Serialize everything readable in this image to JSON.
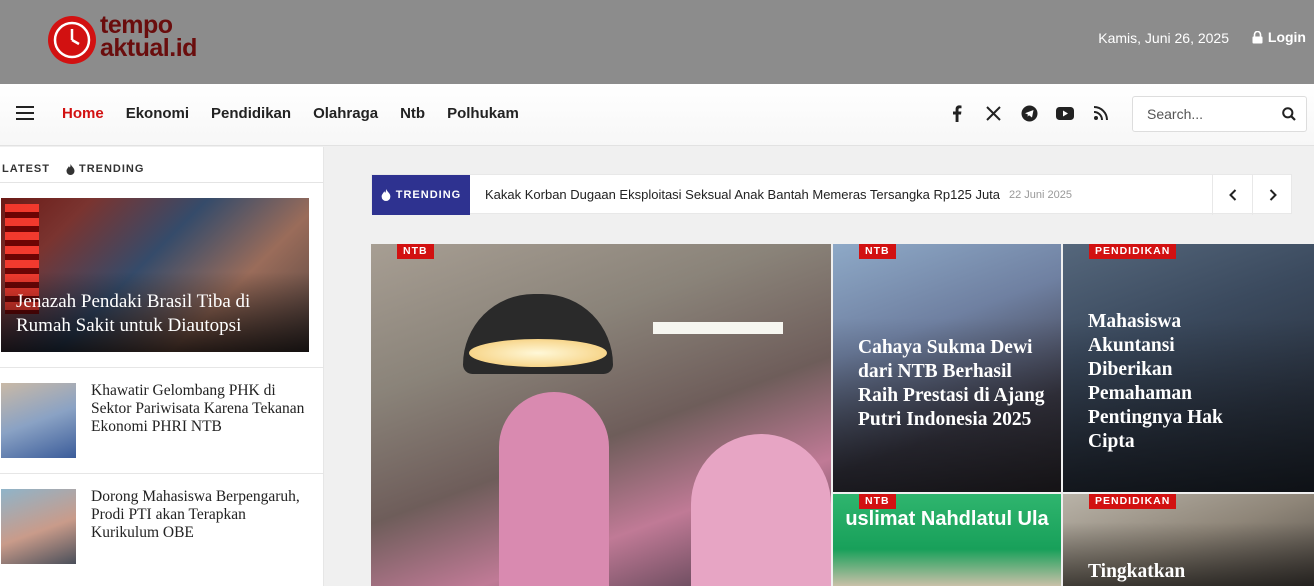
{
  "header": {
    "logo": {
      "line1": "tempo",
      "line2": "aktual.id"
    },
    "date": "Kamis, Juni 26, 2025",
    "login_label": "Login"
  },
  "nav": {
    "items": [
      {
        "label": "Home",
        "active": true
      },
      {
        "label": "Ekonomi"
      },
      {
        "label": "Pendidikan"
      },
      {
        "label": "Olahraga"
      },
      {
        "label": "Ntb"
      },
      {
        "label": "Polhukam"
      }
    ],
    "social_icons": [
      "facebook-icon",
      "x-icon",
      "telegram-icon",
      "youtube-icon",
      "rss-icon"
    ],
    "search": {
      "placeholder": "Search..."
    }
  },
  "sidebar": {
    "tabs": [
      "LATEST",
      "TRENDING"
    ],
    "featured": {
      "title": "Jenazah Pendaki Brasil Tiba di Rumah Sakit untuk Diautopsi"
    },
    "items": [
      {
        "title": "Khawatir Gelombang PHK di Sektor Pariwisata Karena Tekanan Ekonomi PHRI NTB"
      },
      {
        "title": "Dorong Mahasiswa Berpengaruh, Prodi PTI akan Terapkan Kurikulum OBE"
      }
    ]
  },
  "trending": {
    "badge": "TRENDING",
    "headline": "Kakak Korban Dugaan Eksploitasi Seksual Anak Bantah Memeras Tersangka Rp125 Juta",
    "date": "22 Juni 2025"
  },
  "grid": {
    "big": {
      "category": "NTB"
    },
    "cards": [
      {
        "category": "NTB",
        "title": "Cahaya Sukma Dewi dari NTB Berhasil Raih Prestasi di Ajang Putri Indonesia 2025"
      },
      {
        "category": "PENDIDIKAN",
        "title": "Mahasiswa Akuntansi Diberikan Pemahaman Pentingnya Hak Cipta"
      },
      {
        "category": "NTB",
        "banner": "uslimat Nahdlatul Ula"
      },
      {
        "category": "PENDIDIKAN",
        "title": "Tingkatkan"
      }
    ]
  },
  "colors": {
    "accent": "#d21111",
    "trending_badge": "#2e3290",
    "topbar": "#8c8c8c"
  }
}
